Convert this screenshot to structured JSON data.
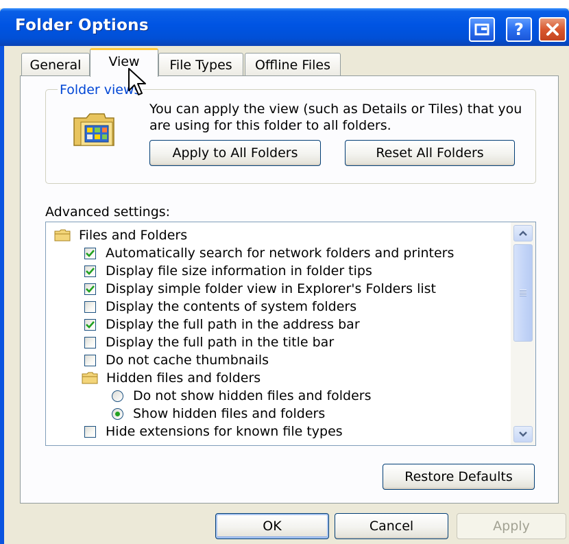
{
  "window": {
    "title": "Folder Options"
  },
  "titlebar_buttons": [
    {
      "icon": "window-switch-icon"
    },
    {
      "icon": "help-icon",
      "label": "?"
    },
    {
      "icon": "close-icon"
    }
  ],
  "tabs": [
    {
      "label": "General",
      "active": false
    },
    {
      "label": "View",
      "active": true
    },
    {
      "label": "File Types",
      "active": false
    },
    {
      "label": "Offline Files",
      "active": false
    }
  ],
  "folder_views": {
    "group_label": "Folder views",
    "description": "You can apply the view (such as Details or Tiles) that you are using for this folder to all folders.",
    "apply_label": "Apply to All Folders",
    "reset_label": "Reset All Folders"
  },
  "advanced": {
    "label": "Advanced settings:",
    "items": [
      {
        "type": "folder",
        "label": "Files and Folders",
        "indent": 0
      },
      {
        "type": "checkbox",
        "label": "Automatically search for network folders and printers",
        "checked": true,
        "indent": 1
      },
      {
        "type": "checkbox",
        "label": "Display file size information in folder tips",
        "checked": true,
        "indent": 1
      },
      {
        "type": "checkbox",
        "label": "Display simple folder view in Explorer's Folders list",
        "checked": true,
        "indent": 1
      },
      {
        "type": "checkbox",
        "label": "Display the contents of system folders",
        "checked": false,
        "indent": 1
      },
      {
        "type": "checkbox",
        "label": "Display the full path in the address bar",
        "checked": true,
        "indent": 1
      },
      {
        "type": "checkbox",
        "label": "Display the full path in the title bar",
        "checked": false,
        "indent": 1
      },
      {
        "type": "checkbox",
        "label": "Do not cache thumbnails",
        "checked": false,
        "indent": 1
      },
      {
        "type": "folder",
        "label": "Hidden files and folders",
        "indent": 1
      },
      {
        "type": "radio",
        "label": "Do not show hidden files and folders",
        "checked": false,
        "indent": 2
      },
      {
        "type": "radio",
        "label": "Show hidden files and folders",
        "checked": true,
        "indent": 2
      },
      {
        "type": "checkbox",
        "label": "Hide extensions for known file types",
        "checked": false,
        "indent": 1
      }
    ]
  },
  "buttons": {
    "restore": "Restore Defaults",
    "ok": "OK",
    "cancel": "Cancel",
    "apply": "Apply"
  },
  "colors": {
    "titlebar": "#0054e3",
    "group_label": "#0046d5",
    "active_tab_accent": "#ffc83c",
    "check_mark": "#21a121"
  }
}
